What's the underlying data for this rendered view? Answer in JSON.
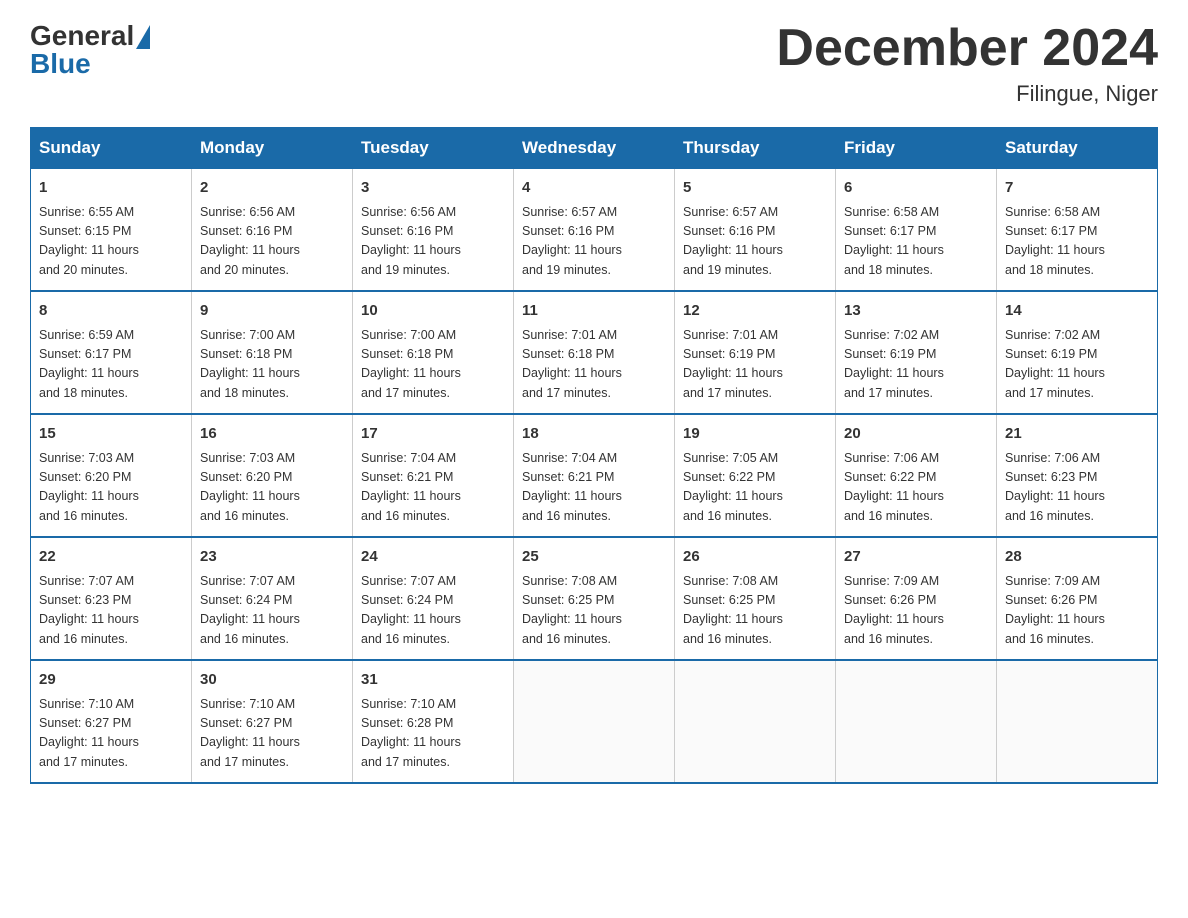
{
  "header": {
    "logo_general": "General",
    "logo_blue": "Blue",
    "title": "December 2024",
    "subtitle": "Filingue, Niger"
  },
  "days_of_week": [
    "Sunday",
    "Monday",
    "Tuesday",
    "Wednesday",
    "Thursday",
    "Friday",
    "Saturday"
  ],
  "weeks": [
    [
      {
        "num": "1",
        "sunrise": "6:55 AM",
        "sunset": "6:15 PM",
        "daylight": "11 hours and 20 minutes."
      },
      {
        "num": "2",
        "sunrise": "6:56 AM",
        "sunset": "6:16 PM",
        "daylight": "11 hours and 20 minutes."
      },
      {
        "num": "3",
        "sunrise": "6:56 AM",
        "sunset": "6:16 PM",
        "daylight": "11 hours and 19 minutes."
      },
      {
        "num": "4",
        "sunrise": "6:57 AM",
        "sunset": "6:16 PM",
        "daylight": "11 hours and 19 minutes."
      },
      {
        "num": "5",
        "sunrise": "6:57 AM",
        "sunset": "6:16 PM",
        "daylight": "11 hours and 19 minutes."
      },
      {
        "num": "6",
        "sunrise": "6:58 AM",
        "sunset": "6:17 PM",
        "daylight": "11 hours and 18 minutes."
      },
      {
        "num": "7",
        "sunrise": "6:58 AM",
        "sunset": "6:17 PM",
        "daylight": "11 hours and 18 minutes."
      }
    ],
    [
      {
        "num": "8",
        "sunrise": "6:59 AM",
        "sunset": "6:17 PM",
        "daylight": "11 hours and 18 minutes."
      },
      {
        "num": "9",
        "sunrise": "7:00 AM",
        "sunset": "6:18 PM",
        "daylight": "11 hours and 18 minutes."
      },
      {
        "num": "10",
        "sunrise": "7:00 AM",
        "sunset": "6:18 PM",
        "daylight": "11 hours and 17 minutes."
      },
      {
        "num": "11",
        "sunrise": "7:01 AM",
        "sunset": "6:18 PM",
        "daylight": "11 hours and 17 minutes."
      },
      {
        "num": "12",
        "sunrise": "7:01 AM",
        "sunset": "6:19 PM",
        "daylight": "11 hours and 17 minutes."
      },
      {
        "num": "13",
        "sunrise": "7:02 AM",
        "sunset": "6:19 PM",
        "daylight": "11 hours and 17 minutes."
      },
      {
        "num": "14",
        "sunrise": "7:02 AM",
        "sunset": "6:19 PM",
        "daylight": "11 hours and 17 minutes."
      }
    ],
    [
      {
        "num": "15",
        "sunrise": "7:03 AM",
        "sunset": "6:20 PM",
        "daylight": "11 hours and 16 minutes."
      },
      {
        "num": "16",
        "sunrise": "7:03 AM",
        "sunset": "6:20 PM",
        "daylight": "11 hours and 16 minutes."
      },
      {
        "num": "17",
        "sunrise": "7:04 AM",
        "sunset": "6:21 PM",
        "daylight": "11 hours and 16 minutes."
      },
      {
        "num": "18",
        "sunrise": "7:04 AM",
        "sunset": "6:21 PM",
        "daylight": "11 hours and 16 minutes."
      },
      {
        "num": "19",
        "sunrise": "7:05 AM",
        "sunset": "6:22 PM",
        "daylight": "11 hours and 16 minutes."
      },
      {
        "num": "20",
        "sunrise": "7:06 AM",
        "sunset": "6:22 PM",
        "daylight": "11 hours and 16 minutes."
      },
      {
        "num": "21",
        "sunrise": "7:06 AM",
        "sunset": "6:23 PM",
        "daylight": "11 hours and 16 minutes."
      }
    ],
    [
      {
        "num": "22",
        "sunrise": "7:07 AM",
        "sunset": "6:23 PM",
        "daylight": "11 hours and 16 minutes."
      },
      {
        "num": "23",
        "sunrise": "7:07 AM",
        "sunset": "6:24 PM",
        "daylight": "11 hours and 16 minutes."
      },
      {
        "num": "24",
        "sunrise": "7:07 AM",
        "sunset": "6:24 PM",
        "daylight": "11 hours and 16 minutes."
      },
      {
        "num": "25",
        "sunrise": "7:08 AM",
        "sunset": "6:25 PM",
        "daylight": "11 hours and 16 minutes."
      },
      {
        "num": "26",
        "sunrise": "7:08 AM",
        "sunset": "6:25 PM",
        "daylight": "11 hours and 16 minutes."
      },
      {
        "num": "27",
        "sunrise": "7:09 AM",
        "sunset": "6:26 PM",
        "daylight": "11 hours and 16 minutes."
      },
      {
        "num": "28",
        "sunrise": "7:09 AM",
        "sunset": "6:26 PM",
        "daylight": "11 hours and 16 minutes."
      }
    ],
    [
      {
        "num": "29",
        "sunrise": "7:10 AM",
        "sunset": "6:27 PM",
        "daylight": "11 hours and 17 minutes."
      },
      {
        "num": "30",
        "sunrise": "7:10 AM",
        "sunset": "6:27 PM",
        "daylight": "11 hours and 17 minutes."
      },
      {
        "num": "31",
        "sunrise": "7:10 AM",
        "sunset": "6:28 PM",
        "daylight": "11 hours and 17 minutes."
      },
      null,
      null,
      null,
      null
    ]
  ]
}
